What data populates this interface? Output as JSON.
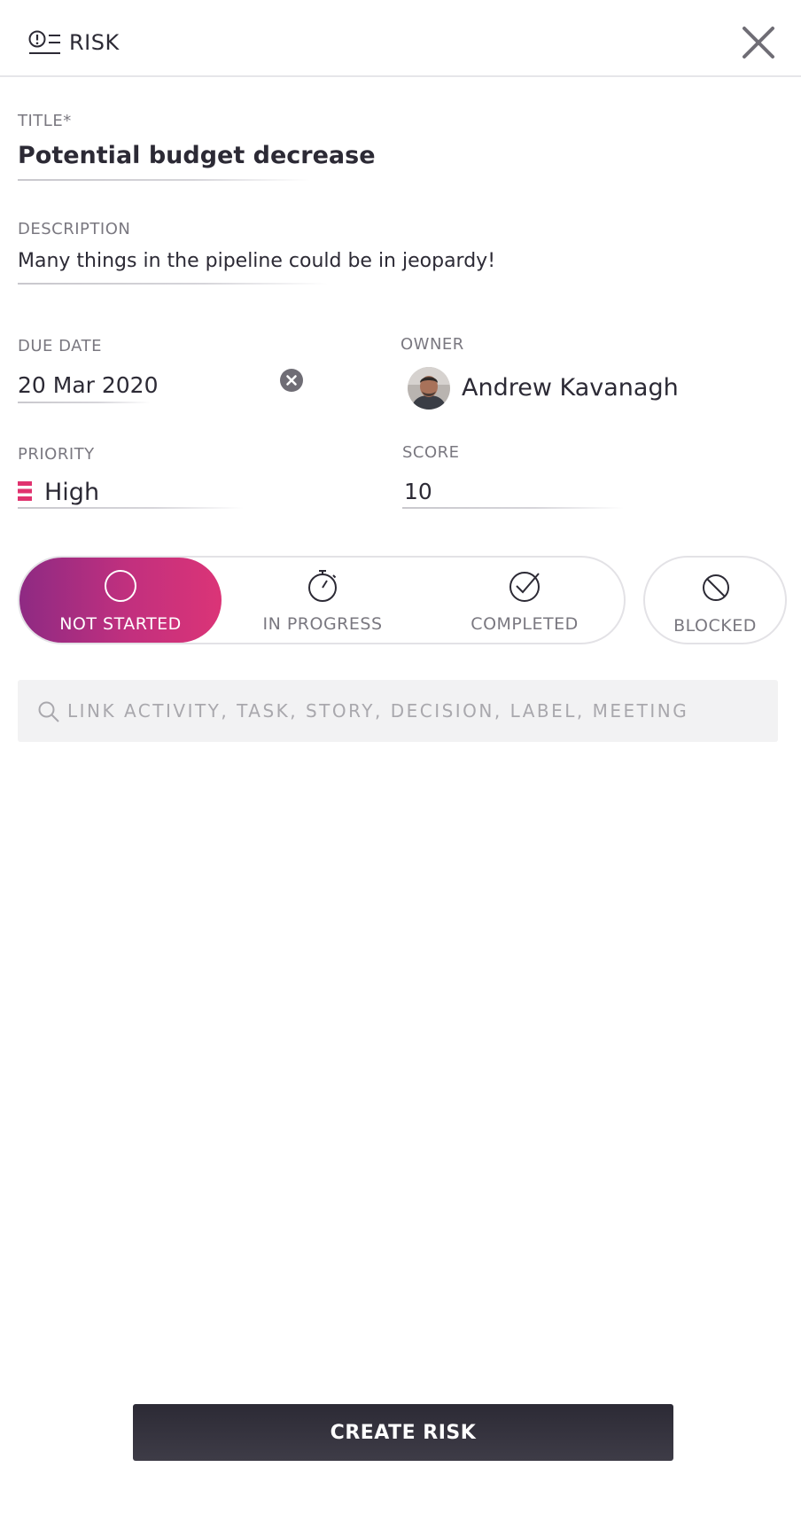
{
  "header": {
    "title": "RISK",
    "icon": "risk-list-icon",
    "close_icon": "close-icon"
  },
  "form": {
    "title": {
      "label": "TITLE*",
      "value": "Potential budget decrease"
    },
    "description": {
      "label": "DESCRIPTION",
      "value": "Many things in the pipeline could be in jeopardy!"
    },
    "due_date": {
      "label": "DUE DATE",
      "value": "20 Mar 2020",
      "clear_icon": "clear-circle-icon"
    },
    "owner": {
      "label": "OWNER",
      "name": "Andrew Kavanagh",
      "avatar": "avatar"
    },
    "priority": {
      "label": "PRIORITY",
      "value": "High",
      "icon": "priority-bars-icon",
      "color": "#e0336f"
    },
    "score": {
      "label": "SCORE",
      "value": "10"
    }
  },
  "status": {
    "options": [
      {
        "label": "NOT STARTED",
        "icon": "circle-icon",
        "active": true
      },
      {
        "label": "IN PROGRESS",
        "icon": "stopwatch-icon",
        "active": false
      },
      {
        "label": "COMPLETED",
        "icon": "check-circle-icon",
        "active": false
      }
    ],
    "blocked": {
      "label": "BLOCKED",
      "icon": "blocked-icon"
    },
    "active_gradient": [
      "#8e2a83",
      "#db3477"
    ]
  },
  "link_search": {
    "placeholder": "LINK ACTIVITY, TASK, STORY, DECISION, LABEL, MEETING",
    "icon": "search-icon"
  },
  "actions": {
    "create_label": "CREATE RISK",
    "create_color": "#2c2a35"
  }
}
